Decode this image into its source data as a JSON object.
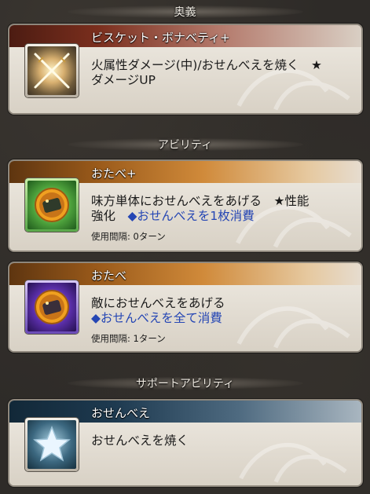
{
  "sections": {
    "ougi": "奥義",
    "ability": "アビリティ",
    "support": "サポートアビリティ"
  },
  "ougi_card": {
    "title": "ビスケット・ボナベティ+",
    "desc_line1": "火属性ダメージ(中)/おせんべえを焼く　★",
    "desc_line2": "ダメージUP",
    "icon": "crossed-swords-icon"
  },
  "abilities": [
    {
      "title": "おたべ+",
      "desc_line1": "味方単体におせんべえをあげる　★性能",
      "desc_line2_plain": "強化　",
      "desc_line2_blue": "◆おせんべえを1枚消費",
      "cooldown_label": "使用間隔: ",
      "cooldown_value": "0ターン",
      "icon": "senbei-green-icon"
    },
    {
      "title": "おたべ",
      "desc_line1": "敵におせんべえをあげる",
      "desc_line2_blue": "◆おせんべえを全て消費",
      "cooldown_label": "使用間隔: ",
      "cooldown_value": "1ターン",
      "icon": "senbei-purple-icon"
    }
  ],
  "support_card": {
    "title": "おせんべえ",
    "desc": "おせんべえを焼く",
    "icon": "star-icon"
  },
  "colors": {
    "ougi_band": "#7a2e1d",
    "ability_band": "#9a5a1a",
    "support_band": "#1e3a50",
    "consume_text": "#2546b4"
  }
}
